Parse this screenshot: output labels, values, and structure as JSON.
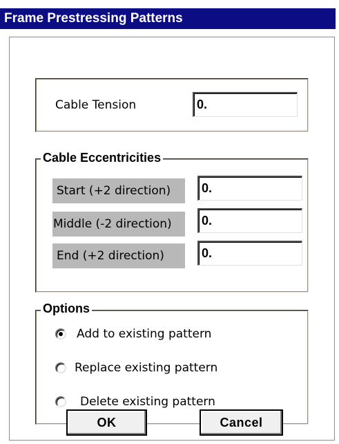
{
  "window": {
    "title": "Frame Prestressing Patterns",
    "title_bar_color": "#0c0c84"
  },
  "cable_tension": {
    "label": "Cable Tension",
    "value": "0."
  },
  "cable_eccentricities": {
    "legend": "Cable Eccentricities",
    "rows": [
      {
        "label": "Start   (+2 direction)",
        "value": "0."
      },
      {
        "label": "Middle (-2 direction)",
        "value": "0."
      },
      {
        "label": "End    (+2 direction)",
        "value": "0."
      }
    ]
  },
  "options": {
    "legend": "Options",
    "choices": [
      {
        "label": "Add to existing pattern",
        "selected": true
      },
      {
        "label": "Replace existing pattern",
        "selected": false
      },
      {
        "label": "Delete existing  pattern",
        "selected": false
      }
    ]
  },
  "buttons": {
    "ok": "OK",
    "cancel": "Cancel"
  }
}
